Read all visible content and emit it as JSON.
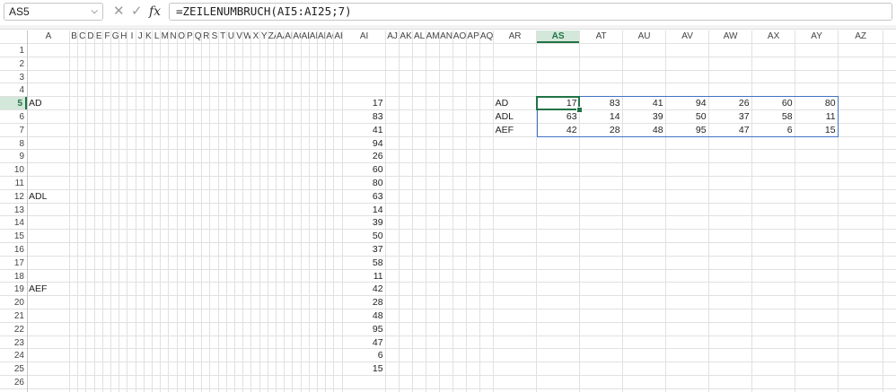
{
  "formula_bar": {
    "name_box": "AS5",
    "cancel_glyph": "✕",
    "enter_glyph": "✓",
    "fx_label": "fx",
    "formula": "=ZEILENUMBRUCH(AI5:AI25;7)"
  },
  "active_cell": {
    "column": "AS",
    "row": 5
  },
  "columns": [
    "A",
    "B",
    "C",
    "D",
    "E",
    "F",
    "G",
    "H",
    "I",
    "J",
    "K",
    "L",
    "M",
    "N",
    "O",
    "P",
    "Q",
    "R",
    "S",
    "T",
    "U",
    "V",
    "W",
    "X",
    "Y",
    "Z",
    "AA",
    "AB",
    "AC",
    "AD",
    "AE",
    "AF",
    "AG",
    "AH",
    "AI",
    "AJ",
    "AK",
    "AL",
    "AM",
    "AN",
    "AO",
    "AP",
    "AQ",
    "AR",
    "AS",
    "AT",
    "AU",
    "AV",
    "AW",
    "AX",
    "AY",
    "AZ"
  ],
  "visible_column_labels": [
    "A",
    "B",
    "C",
    "D",
    "E",
    "F",
    "G",
    "H",
    "I",
    "J",
    "K",
    "L",
    "M",
    "N",
    "O",
    "P",
    "Q",
    "R",
    "S",
    "T",
    "U",
    "V",
    "W",
    "X",
    "Y",
    "ZA",
    "AA",
    "AB",
    "AC",
    "AD",
    "AE",
    "AF",
    "AG",
    "AH",
    "AI",
    "AJ",
    "AK",
    "AL",
    "AM",
    "AN",
    "AO",
    "AP",
    "AQ",
    "AR",
    "AS",
    "AT",
    "AU",
    "AV",
    "AW",
    "AX",
    "AY",
    "AZ"
  ],
  "rows": [
    1,
    2,
    3,
    4,
    5,
    6,
    7,
    8,
    9,
    10,
    11,
    12,
    13,
    14,
    15,
    16,
    17,
    18,
    19,
    20,
    21,
    22,
    23,
    24,
    25,
    26
  ],
  "cells": [
    {
      "col": "A",
      "row": 5,
      "value": "AD",
      "kind": "text"
    },
    {
      "col": "A",
      "row": 12,
      "value": "ADL",
      "kind": "text"
    },
    {
      "col": "A",
      "row": 19,
      "value": "AEF",
      "kind": "text"
    },
    {
      "col": "AI",
      "row": 5,
      "value": "17",
      "kind": "num"
    },
    {
      "col": "AI",
      "row": 6,
      "value": "83",
      "kind": "num"
    },
    {
      "col": "AI",
      "row": 7,
      "value": "41",
      "kind": "num"
    },
    {
      "col": "AI",
      "row": 8,
      "value": "94",
      "kind": "num"
    },
    {
      "col": "AI",
      "row": 9,
      "value": "26",
      "kind": "num"
    },
    {
      "col": "AI",
      "row": 10,
      "value": "60",
      "kind": "num"
    },
    {
      "col": "AI",
      "row": 11,
      "value": "80",
      "kind": "num"
    },
    {
      "col": "AI",
      "row": 12,
      "value": "63",
      "kind": "num"
    },
    {
      "col": "AI",
      "row": 13,
      "value": "14",
      "kind": "num"
    },
    {
      "col": "AI",
      "row": 14,
      "value": "39",
      "kind": "num"
    },
    {
      "col": "AI",
      "row": 15,
      "value": "50",
      "kind": "num"
    },
    {
      "col": "AI",
      "row": 16,
      "value": "37",
      "kind": "num"
    },
    {
      "col": "AI",
      "row": 17,
      "value": "58",
      "kind": "num"
    },
    {
      "col": "AI",
      "row": 18,
      "value": "11",
      "kind": "num"
    },
    {
      "col": "AI",
      "row": 19,
      "value": "42",
      "kind": "num"
    },
    {
      "col": "AI",
      "row": 20,
      "value": "28",
      "kind": "num"
    },
    {
      "col": "AI",
      "row": 21,
      "value": "48",
      "kind": "num"
    },
    {
      "col": "AI",
      "row": 22,
      "value": "95",
      "kind": "num"
    },
    {
      "col": "AI",
      "row": 23,
      "value": "47",
      "kind": "num"
    },
    {
      "col": "AI",
      "row": 24,
      "value": "6",
      "kind": "num"
    },
    {
      "col": "AI",
      "row": 25,
      "value": "15",
      "kind": "num"
    },
    {
      "col": "AR",
      "row": 5,
      "value": "AD",
      "kind": "text"
    },
    {
      "col": "AR",
      "row": 6,
      "value": "ADL",
      "kind": "text"
    },
    {
      "col": "AR",
      "row": 7,
      "value": "AEF",
      "kind": "text"
    },
    {
      "col": "AS",
      "row": 5,
      "value": "17",
      "kind": "num"
    },
    {
      "col": "AT",
      "row": 5,
      "value": "83",
      "kind": "num"
    },
    {
      "col": "AU",
      "row": 5,
      "value": "41",
      "kind": "num"
    },
    {
      "col": "AV",
      "row": 5,
      "value": "94",
      "kind": "num"
    },
    {
      "col": "AW",
      "row": 5,
      "value": "26",
      "kind": "num"
    },
    {
      "col": "AX",
      "row": 5,
      "value": "60",
      "kind": "num"
    },
    {
      "col": "AY",
      "row": 5,
      "value": "80",
      "kind": "num"
    },
    {
      "col": "AS",
      "row": 6,
      "value": "63",
      "kind": "num"
    },
    {
      "col": "AT",
      "row": 6,
      "value": "14",
      "kind": "num"
    },
    {
      "col": "AU",
      "row": 6,
      "value": "39",
      "kind": "num"
    },
    {
      "col": "AV",
      "row": 6,
      "value": "50",
      "kind": "num"
    },
    {
      "col": "AW",
      "row": 6,
      "value": "37",
      "kind": "num"
    },
    {
      "col": "AX",
      "row": 6,
      "value": "58",
      "kind": "num"
    },
    {
      "col": "AY",
      "row": 6,
      "value": "11",
      "kind": "num"
    },
    {
      "col": "AS",
      "row": 7,
      "value": "42",
      "kind": "num"
    },
    {
      "col": "AT",
      "row": 7,
      "value": "28",
      "kind": "num"
    },
    {
      "col": "AU",
      "row": 7,
      "value": "48",
      "kind": "num"
    },
    {
      "col": "AV",
      "row": 7,
      "value": "95",
      "kind": "num"
    },
    {
      "col": "AW",
      "row": 7,
      "value": "47",
      "kind": "num"
    },
    {
      "col": "AX",
      "row": 7,
      "value": "6",
      "kind": "num"
    },
    {
      "col": "AY",
      "row": 7,
      "value": "15",
      "kind": "num"
    }
  ],
  "spill_range": {
    "from_col": "AS",
    "from_row": 5,
    "to_col": "AY",
    "to_row": 7
  },
  "colors": {
    "accent": "#217346",
    "spill_border": "#4472c4",
    "header_highlight": "#d3e7da",
    "gridline": "#e1e1e1"
  }
}
